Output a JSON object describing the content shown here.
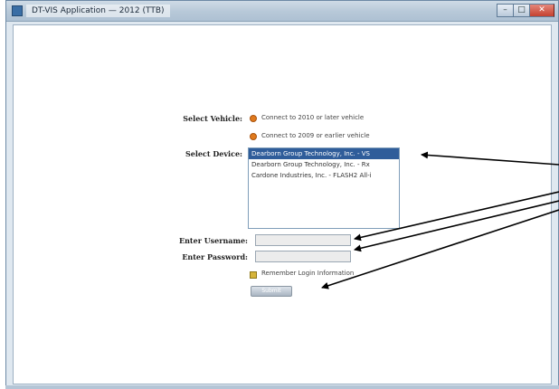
{
  "window": {
    "title": "DT-VIS Application — 2012 (TTB)",
    "controls": {
      "minimize": "–",
      "maximize": "□",
      "close": "✕"
    }
  },
  "form": {
    "select_vehicle_label": "Select Vehicle:",
    "vehicle_options": [
      {
        "label": "Connect to 2010 or later vehicle",
        "selected": true
      },
      {
        "label": "Connect to 2009 or earlier vehicle",
        "selected": false
      }
    ],
    "select_device_label": "Select Device:",
    "devices": [
      {
        "label": "Dearborn Group Technology, Inc. - VS",
        "selected": true
      },
      {
        "label": "Dearborn Group Technology, Inc. - Rx",
        "selected": false
      },
      {
        "label": "Cardone Industries, Inc. - FLASH2 All-i",
        "selected": false
      }
    ],
    "username_label": "Enter Username:",
    "username_value": "",
    "password_label": "Enter Password:",
    "password_value": "",
    "remember_label": "Remember Login Information",
    "remember_checked": true,
    "submit_label": "Submit"
  },
  "colors": {
    "accent": "#e07a1d",
    "selection": "#2f5d9a",
    "checkbox": "#d6b43a"
  }
}
